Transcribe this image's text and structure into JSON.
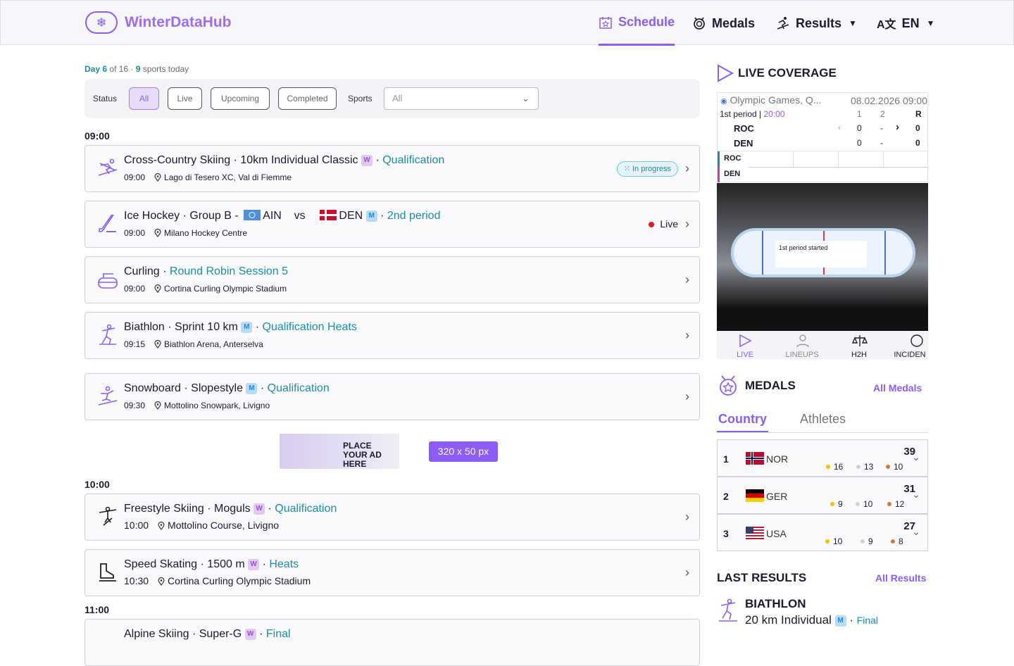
{
  "header": {
    "app_name": "WinterDataHub",
    "nav": {
      "schedule": "Schedule",
      "medals": "Medals",
      "results": "Results",
      "language": "EN"
    }
  },
  "meta": {
    "day_label": "Day",
    "day": "6",
    "of_label": "of 16 ·",
    "sports": "9",
    "sports_label": "sports today"
  },
  "filters": {
    "status_label": "Status",
    "all": "All",
    "live": "Live",
    "upcoming": "Upcoming",
    "completed": "Completed",
    "sports_label": "Sports",
    "sports_value": "All"
  },
  "times": {
    "t1": "09:00",
    "t2": "10:00",
    "t3": "11:00"
  },
  "events": [
    {
      "sport": "Cross-Country Skiing",
      "detail": "10km Individual Classic",
      "gender": "W",
      "stage": "Qualification",
      "time": "09:00",
      "venue": "Lago di Tesero XC, Val di Fiemme",
      "status": "In progress"
    },
    {
      "sport": "Ice Hockey",
      "detail": "Group B -",
      "team1": "AIN",
      "vs": "vs",
      "team2": "DEN",
      "gender": "M",
      "stage": "2nd period",
      "time": "09:00",
      "venue": "Milano Hockey Centre",
      "status": "Live"
    },
    {
      "sport": "Curling",
      "stage": "Round Robin Session 5",
      "time": "09:00",
      "venue": "Cortina Curling Olympic Stadium"
    },
    {
      "sport": "Biathlon",
      "detail": "Sprint 10 km",
      "gender": "M",
      "stage": "Qualification Heats",
      "time": "09:15",
      "venue": "Biathlon Arena, Anterselva"
    },
    {
      "sport": "Snowboard",
      "detail": "Slopestyle",
      "gender": "M",
      "stage": "Qualification",
      "time": "09:30",
      "venue": "Mottolino Snowpark, Livigno"
    },
    {
      "sport": "Freestyle Skiing",
      "detail": "Moguls",
      "gender": "W",
      "stage": "Qualification",
      "time": "10:00",
      "venue": "Mottolino Course, Livigno"
    },
    {
      "sport": "Speed Skating",
      "detail": "1500 m",
      "gender": "W",
      "stage": "Heats",
      "time": "10:30",
      "venue": "Cortina Curling Olympic Stadium"
    },
    {
      "sport": "Alpine Skiing",
      "detail": "Super-G",
      "gender": "W",
      "stage": "Final"
    }
  ],
  "ad": {
    "line1": "PLACE",
    "line2": "YOUR AD HERE",
    "size": "320 x 50 px"
  },
  "live": {
    "title": "LIVE COVERAGE",
    "competition": "Olympic Games, Q...",
    "datetime": "08.02.2026 09:00",
    "period": "1st period",
    "clock": "20:00",
    "col1": "1",
    "col2": "2",
    "colr": "R",
    "team1": "ROC",
    "team2": "DEN",
    "s11": "0",
    "s12": "-",
    "s1r": "0",
    "s21": "0",
    "s22": "-",
    "s2r": "0",
    "popup": "1st period started",
    "tab_live": "LIVE",
    "tab_lineups": "LINEUPS",
    "tab_h2h": "H2H",
    "tab_incidents": "INCIDEN"
  },
  "medals": {
    "title": "MEDALS",
    "all": "All Medals",
    "tab_country": "Country",
    "tab_athletes": "Athletes",
    "rows": [
      {
        "rank": "1",
        "code": "NOR",
        "total": "39",
        "gold": "16",
        "silver": "13",
        "bronze": "10"
      },
      {
        "rank": "2",
        "code": "GER",
        "total": "31",
        "gold": "9",
        "silver": "10",
        "bronze": "12"
      },
      {
        "rank": "3",
        "code": "USA",
        "total": "27",
        "gold": "10",
        "silver": "9",
        "bronze": "8"
      }
    ]
  },
  "results": {
    "title": "LAST RESULTS",
    "all": "All Results",
    "sport": "BIATHLON",
    "event": "20 km Individual",
    "gender": "M",
    "stage": "Final"
  },
  "colors": {
    "accent": "#8b5cf6",
    "stage": "#1a8fa0",
    "live_dot": "#e01b24",
    "gold": "#f2c200",
    "silver": "#d0d0d0",
    "bronze": "#d07a2d"
  }
}
